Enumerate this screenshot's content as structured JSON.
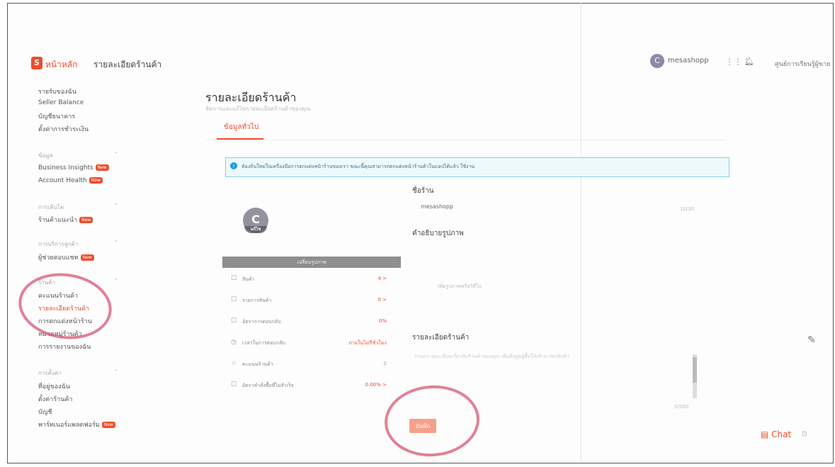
{
  "topbar": {
    "logo": "S",
    "home": "หน้าหลัก",
    "breadcrumb": "รายละเอียดร้านค้า",
    "user_initial": "C",
    "username": "mesashopp",
    "help": "ศูนย์การเรียนรู้ผู้ขาย"
  },
  "sidebar": {
    "items_finance": [
      "รายรับของฉัน",
      "Seller Balance",
      "บัญชีธนาคาร",
      "ตั้งค่าการชำระเงิน"
    ],
    "section_data": "ข้อมูล",
    "items_data": [
      "Business Insights",
      "Account Health"
    ],
    "section_growth": "การเติบโต",
    "items_growth": [
      "ร้านค้าแนะนำ"
    ],
    "section_service": "การบริการลูกค้า",
    "items_service": [
      "ผู้ช่วยตอบแชท"
    ],
    "section_shop": "ร้านค้า",
    "items_shop": [
      "คะแนนร้านค้า",
      "รายละเอียดร้านค้า",
      "การตกแต่งหน้าร้าน",
      "หมวดหมู่ร้านค้า",
      "การรายงานของฉัน"
    ],
    "section_settings": "การตั้งค่า",
    "items_settings": [
      "ที่อยู่ของฉัน",
      "ตั้งค่าร้านค้า",
      "บัญชี",
      "พาร์ทเนอร์แพลตฟอร์ม"
    ],
    "badge": "New"
  },
  "main": {
    "title": "รายละเอียดร้านค้า",
    "subtitle": "จัดการและแก้ไขรายละเอียดร้านค้าของคุณ",
    "tab": "ข้อมูลทั่วไป",
    "notice": "ท้องถิ่นใหม่ในเครื่องมือการตกแต่งหน้าร้านของเรา ขณะนี้คุณสามารถตกแต่งหน้าร้านค้าในแอปได้แล้ว ใช้งาน"
  },
  "preview": {
    "avatar_initial": "C",
    "avatar_edit": "แก้ไข",
    "cover_button": "เปลี่ยนรูปภาพ",
    "rows": [
      {
        "icon": "☐",
        "label": "สินค้า",
        "value": "4 >"
      },
      {
        "icon": "☐",
        "label": "รายการสินค้า",
        "value": "0 >"
      },
      {
        "icon": "☐",
        "label": "อัตราการตอบกลับ",
        "value": "0%"
      },
      {
        "icon": "◷",
        "label": "เวลาในการตอบกลับ",
        "value": "ภายในไม่กี่ชั่วโมง"
      },
      {
        "icon": "☆",
        "label": "คะแนนร้านค้า",
        "value": "0"
      },
      {
        "icon": "☐",
        "label": "อัตราคำสั่งซื้อที่ไม่สำเร็จ",
        "value": "0.00% >"
      }
    ]
  },
  "form": {
    "shop_name_label": "ชื่อร้าน",
    "shop_name_value": "mesashopp",
    "shop_name_count": "10/30",
    "image_desc_label": "คำอธิบายรูปภาพ",
    "upload_hint": "เพิ่มรูปภาพหรือวิดีโอ",
    "desc_label": "รายละเอียดร้านค้า",
    "desc_placeholder": "กรอกรายละเอียดเกี่ยวกับร้านค้าของคุณ เพื่อดึงดูดผู้ซื้อให้เข้ามาชมสินค้า",
    "desc_count": "0/500",
    "save": "บันทึก"
  },
  "chat": {
    "label": "Chat"
  }
}
